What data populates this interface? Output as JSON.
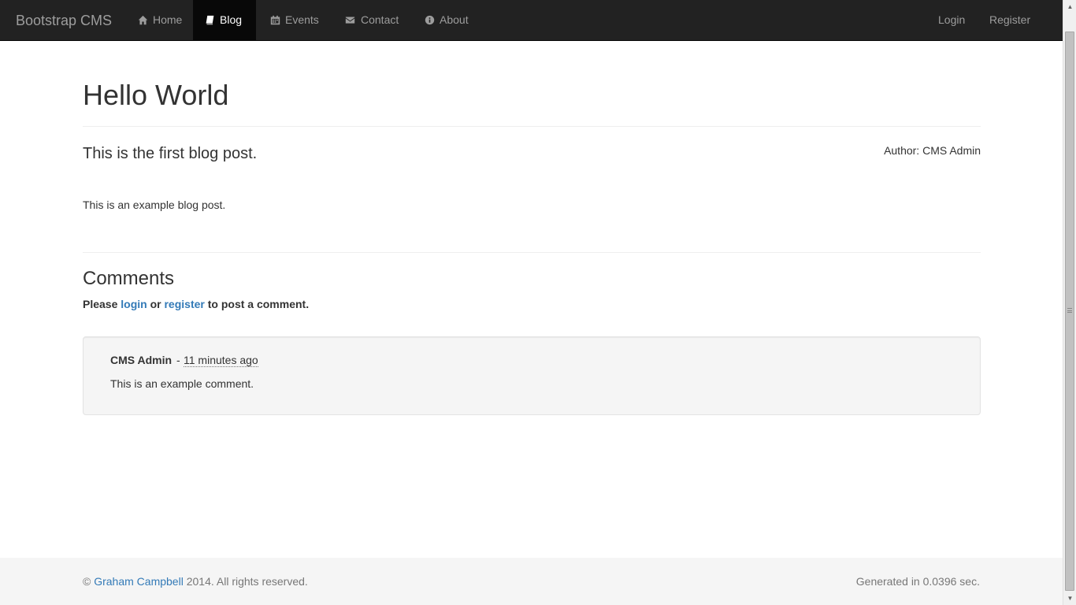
{
  "navbar": {
    "brand": "Bootstrap CMS",
    "items": [
      {
        "label": "Home",
        "icon": "home-icon"
      },
      {
        "label": "Blog",
        "icon": "book-icon",
        "active": true
      },
      {
        "label": "Events",
        "icon": "calendar-icon"
      },
      {
        "label": "Contact",
        "icon": "envelope-icon"
      },
      {
        "label": "About",
        "icon": "info-circle-icon"
      }
    ],
    "right": {
      "login": "Login",
      "register": "Register"
    }
  },
  "post": {
    "title": "Hello World",
    "summary": "This is the first blog post.",
    "author": "Author: CMS Admin",
    "body": "This is an example blog post."
  },
  "comments": {
    "heading": "Comments",
    "prompt_pre": "Please",
    "login_link": "login",
    "prompt_or": "or",
    "register_link": "register",
    "prompt_post": "to post a comment.",
    "items": [
      {
        "author": "CMS Admin",
        "separator": "-",
        "time": "11 minutes ago",
        "text": "This is an example comment."
      }
    ]
  },
  "footer": {
    "copyright_symbol": "©",
    "owner": "Graham Campbell",
    "rights": "2014. All rights reserved.",
    "generated": "Generated in 0.0396 sec."
  },
  "colors": {
    "navbar_bg": "#222222",
    "link": "#337ab7",
    "footer_bg": "#f5f5f5"
  }
}
